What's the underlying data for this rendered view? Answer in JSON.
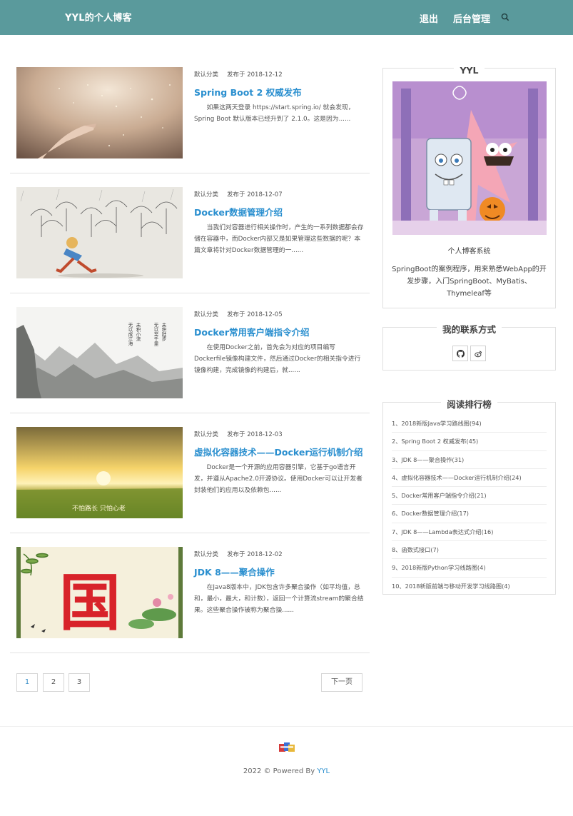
{
  "header": {
    "brand": "YYL的个人博客",
    "nav": {
      "logout": "退出",
      "admin": "后台管理"
    },
    "bg_color": "#5a9a9c"
  },
  "posts": [
    {
      "category": "默认分类",
      "date": "发布于 2018-12-12",
      "title": "Spring Boot 2 权威发布",
      "excerpt": "如果这两天登录 https://start.spring.io/ 就会发现，Spring Boot 默认版本已经升到了 2.1.0。这是因为......"
    },
    {
      "category": "默认分类",
      "date": "发布于 2018-12-07",
      "title": "Docker数据管理介绍",
      "excerpt": "当我们对容器进行相关操作时，产生的一系列数据都会存储在容器中，而Docker内部又是如果管理这些数据的呢？本篇文章将针对Docker数据管理的一......"
    },
    {
      "category": "默认分类",
      "date": "发布于 2018-12-05",
      "title": "Docker常用客户端指令介绍",
      "excerpt": "在使用Docker之前，首先会为对应的项目编写Dockerfile镜像构建文件，然后通过Docker的相关指令进行镜像构建，完成镜像的构建后，就......"
    },
    {
      "category": "默认分类",
      "date": "发布于 2018-12-03",
      "title": "虚拟化容器技术——Docker运行机制介绍",
      "excerpt": "Docker是一个开源的应用容器引擎，它基于go语言开发，并遵从Apache2.0开源协议。使用Docker可以让开发者封装他们的应用以及依赖包......"
    },
    {
      "category": "默认分类",
      "date": "发布于 2018-12-02",
      "title": "JDK 8——聚合操作",
      "excerpt": "在Java8版本中，JDK包含许多聚合操作（如平均值，总和，最小，最大，和计数），返回一个计算流stream的聚合结果。这些聚合操作被称为聚合操......"
    }
  ],
  "thumb_captions": {
    "poem": "未积跬步 无以至千里 未积小流 无以成江海",
    "field": "不怕路长 只怕心老",
    "seal": "国"
  },
  "pagination": {
    "pages": [
      "1",
      "2",
      "3"
    ],
    "current": "1",
    "next": "下一页"
  },
  "sidebar": {
    "profile": {
      "title": "YYL",
      "subtitle": "个人博客系统",
      "description": "SpringBoot的案例程序，用来熟悉WebApp的开发步骤，入门SpringBoot、MyBatis、Thymeleaf等"
    },
    "contact": {
      "title": "我的联系方式",
      "icons": [
        "github-icon",
        "weibo-icon"
      ]
    },
    "ranking": {
      "title": "阅读排行榜",
      "items": [
        "1、2018新版Java学习路线图(94)",
        "2、Spring Boot 2 权威发布(45)",
        "3、JDK 8——聚合操作(31)",
        "4、虚拟化容器技术——Docker运行机制介绍(24)",
        "5、Docker常用客户端指令介绍(21)",
        "6、Docker数据管理介绍(17)",
        "7、JDK 8——Lambda表达式介绍(16)",
        "8、函数式接口(7)",
        "9、2018新版Python学习线路图(4)",
        "10、2018新版前端与移动开发学习线路图(4)"
      ]
    }
  },
  "footer": {
    "text": "2022 © Powered By",
    "link": "YYL"
  },
  "colors": {
    "accent": "#2a8fcf",
    "border": "#e2e2e2"
  }
}
